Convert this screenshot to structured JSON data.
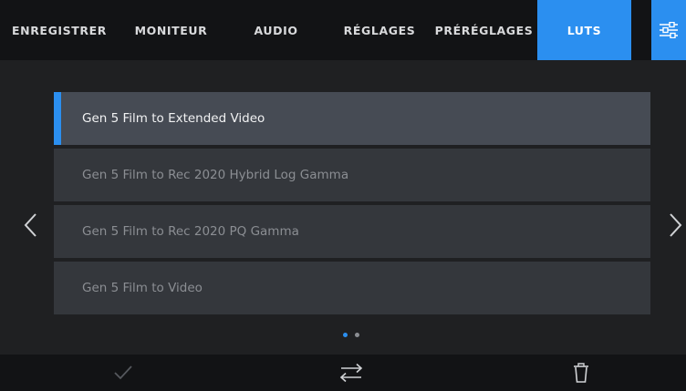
{
  "tabs": [
    {
      "label": "ENREGISTRER",
      "active": false
    },
    {
      "label": "MONITEUR",
      "active": false
    },
    {
      "label": "AUDIO",
      "active": false
    },
    {
      "label": "RÉGLAGES",
      "active": false
    },
    {
      "label": "PRÉRÉGLAGES",
      "active": false
    },
    {
      "label": "LUTS",
      "active": true
    }
  ],
  "settings_icon": "sliders-icon",
  "lut_list": {
    "items": [
      {
        "label": "Gen 5 Film to Extended Video",
        "selected": true
      },
      {
        "label": "Gen 5 Film to Rec 2020 Hybrid Log Gamma",
        "selected": false
      },
      {
        "label": "Gen 5 Film to Rec 2020 PQ Gamma",
        "selected": false
      },
      {
        "label": "Gen 5 Film to Video",
        "selected": false
      }
    ]
  },
  "pagination": {
    "current_page": 1,
    "total_pages": 2
  },
  "toolbar": {
    "icons": [
      "checkmark-icon",
      "swap-arrows-icon",
      "trash-icon"
    ]
  },
  "colors": {
    "accent": "#2b8ff0",
    "background": "#1f2022",
    "bar": "#121315",
    "item": "#34373c",
    "item_selected": "#464b54"
  }
}
